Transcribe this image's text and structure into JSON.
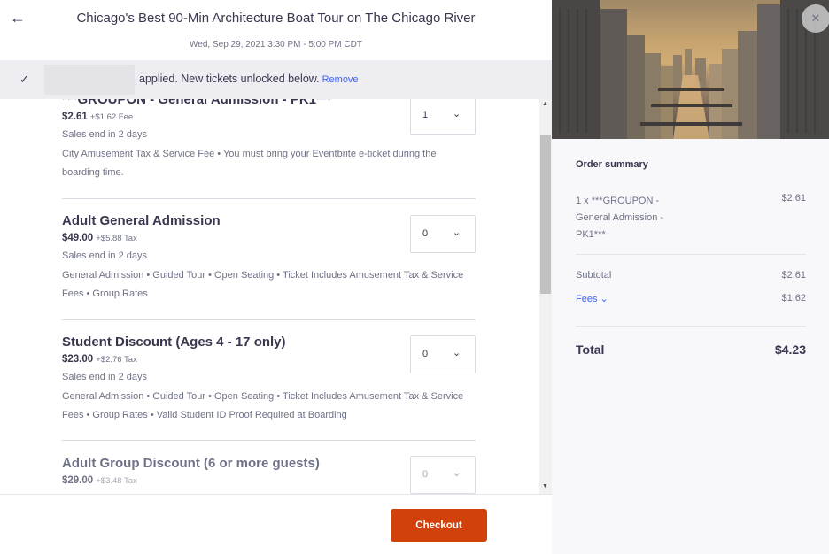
{
  "header": {
    "title": "Chicago's Best 90-Min Architecture Boat Tour on The Chicago River",
    "date": "Wed, Sep 29, 2021 3:30 PM - 5:00 PM CDT",
    "back_icon": "←"
  },
  "promo": {
    "check_icon": "✓",
    "message": "applied. New tickets unlocked below.",
    "remove_label": "Remove"
  },
  "tickets": [
    {
      "name": "***GROUPON - General Admission - PK1***",
      "price": "$2.61",
      "fee": "+$1.62 Fee",
      "sales": "Sales end in 2 days",
      "desc": "City Amusement Tax & Service Fee • You must bring your Eventbrite e-ticket during the boarding time.",
      "qty": "1"
    },
    {
      "name": "Adult General Admission",
      "price": "$49.00",
      "fee": "+$5.88 Tax",
      "sales": "Sales end in 2 days",
      "desc": "General Admission • Guided Tour • Open Seating • Ticket Includes Amusement Tax & Service Fees • Group Rates",
      "qty": "0"
    },
    {
      "name": "Student Discount (Ages 4 - 17 only)",
      "price": "$23.00",
      "fee": "+$2.76 Tax",
      "sales": "Sales end in 2 days",
      "desc": "General Admission • Guided Tour • Open Seating • Ticket Includes Amusement Tax & Service Fees • Group Rates • Valid Student ID Proof Required at Boarding",
      "qty": "0"
    },
    {
      "name": "Adult Group Discount (6 or more guests)",
      "price": "$29.00",
      "fee": "+$3.48 Tax",
      "qty": "0"
    }
  ],
  "chevron": "⌄",
  "footer": {
    "checkout_label": "Checkout"
  },
  "close_icon": "✕",
  "summary": {
    "heading": "Order summary",
    "line_item": "1 x ***GROUPON - General Admission - PK1***",
    "line_amount": "$2.61",
    "subtotal_label": "Subtotal",
    "subtotal": "$2.61",
    "fees_label": "Fees ⌄",
    "fees": "$1.62",
    "total_label": "Total",
    "total": "$4.23"
  },
  "colors": {
    "accent": "#d1410c",
    "link": "#3d64ff",
    "text": "#39364f",
    "muted": "#6f7287"
  }
}
